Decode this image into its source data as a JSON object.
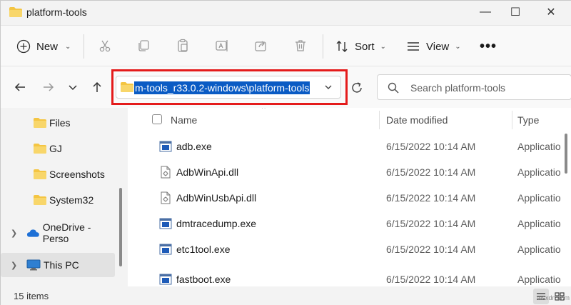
{
  "window": {
    "title": "platform-tools",
    "minimize": "—",
    "maximize": "☐",
    "close": "✕"
  },
  "commandbar": {
    "new_label": "New",
    "sort_label": "Sort",
    "view_label": "View",
    "more_label": "•••"
  },
  "address": {
    "path": "m-tools_r33.0.2-windows\\platform-tools"
  },
  "search": {
    "placeholder": "Search platform-tools"
  },
  "sidebar": {
    "items": [
      {
        "label": "Files"
      },
      {
        "label": "GJ"
      },
      {
        "label": "Screenshots"
      },
      {
        "label": "System32"
      },
      {
        "label": "OneDrive - Perso"
      },
      {
        "label": "This PC"
      }
    ]
  },
  "columns": {
    "name": "Name",
    "date": "Date modified",
    "type": "Type"
  },
  "files": [
    {
      "name": "adb.exe",
      "date": "6/15/2022 10:14 AM",
      "type": "Applicatio",
      "icon": "exe-icon"
    },
    {
      "name": "AdbWinApi.dll",
      "date": "6/15/2022 10:14 AM",
      "type": "Applicatio",
      "icon": "dll-icon"
    },
    {
      "name": "AdbWinUsbApi.dll",
      "date": "6/15/2022 10:14 AM",
      "type": "Applicatio",
      "icon": "dll-icon"
    },
    {
      "name": "dmtracedump.exe",
      "date": "6/15/2022 10:14 AM",
      "type": "Applicatio",
      "icon": "exe-icon"
    },
    {
      "name": "etc1tool.exe",
      "date": "6/15/2022 10:14 AM",
      "type": "Applicatio",
      "icon": "exe-icon"
    },
    {
      "name": "fastboot.exe",
      "date": "6/15/2022 10:14 AM",
      "type": "Applicatio",
      "icon": "exe-icon"
    }
  ],
  "status": {
    "count": "15 items"
  },
  "watermark": "wsxdn.com",
  "colors": {
    "selection": "#0a5bc4",
    "highlight_border": "#e41b1b",
    "folder": "#f4c542"
  }
}
